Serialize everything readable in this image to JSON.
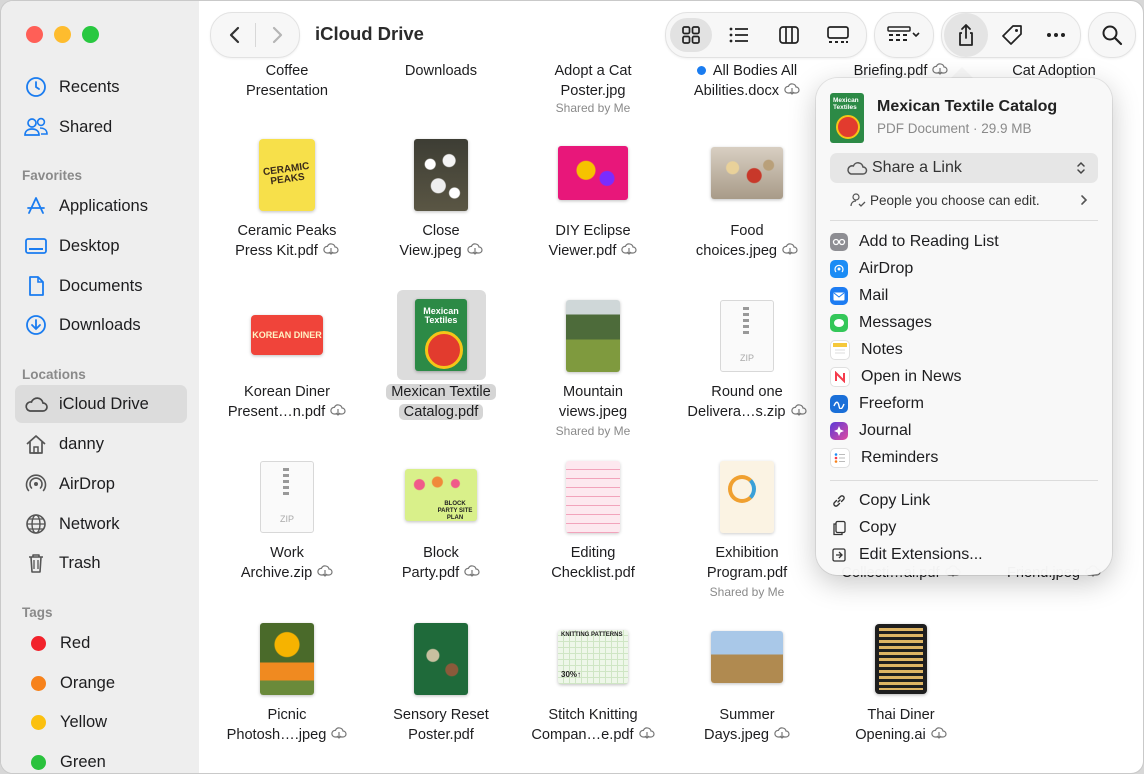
{
  "window": {
    "title": "iCloud Drive"
  },
  "sidebar": {
    "top_items": [
      {
        "label": "Recents",
        "icon": "clock-icon"
      },
      {
        "label": "Shared",
        "icon": "people-icon"
      }
    ],
    "favorites_header": "Favorites",
    "favorites": [
      {
        "label": "Applications",
        "icon": "applications-icon"
      },
      {
        "label": "Desktop",
        "icon": "desktop-icon"
      },
      {
        "label": "Documents",
        "icon": "document-icon"
      },
      {
        "label": "Downloads",
        "icon": "download-icon"
      }
    ],
    "locations_header": "Locations",
    "locations": [
      {
        "label": "iCloud Drive",
        "icon": "cloud-icon",
        "active": true
      },
      {
        "label": "danny",
        "icon": "home-icon"
      },
      {
        "label": "AirDrop",
        "icon": "airdrop-icon"
      },
      {
        "label": "Network",
        "icon": "globe-icon"
      },
      {
        "label": "Trash",
        "icon": "trash-icon"
      }
    ],
    "tags_header": "Tags",
    "tags": [
      {
        "label": "Red",
        "color": "#f2222b"
      },
      {
        "label": "Orange",
        "color": "#f7821b"
      },
      {
        "label": "Yellow",
        "color": "#fbc00f"
      },
      {
        "label": "Green",
        "color": "#2ac23d"
      }
    ]
  },
  "files": [
    {
      "l1": "Coffee",
      "l2": "Presentation"
    },
    {
      "l1": "Downloads",
      "l2": ""
    },
    {
      "l1": "Adopt a Cat",
      "l2": "Poster.jpg",
      "sub": "Shared by Me"
    },
    {
      "l1": "All Bodies All",
      "l2": "Abilities.docx"
    },
    {
      "l1": "Briefing.pdf",
      "l2": ""
    },
    {
      "l1": "Cat Adoption",
      "l2": ""
    },
    {
      "l1": "Ceramic Peaks",
      "l2": "Press Kit.pdf"
    },
    {
      "l1": "Close",
      "l2": "View.jpeg"
    },
    {
      "l1": "DIY Eclipse",
      "l2": "Viewer.pdf"
    },
    {
      "l1": "Food",
      "l2": "choices.jpeg"
    },
    {
      "l1": "Korean Diner",
      "l2": "Present…n.pdf"
    },
    {
      "l1": "Mexican Textile",
      "l2": "Catalog.pdf"
    },
    {
      "l1": "Mountain",
      "l2": "views.jpeg",
      "sub": "Shared by Me"
    },
    {
      "l1": "Round one",
      "l2": "Delivera…s.zip"
    },
    {
      "l1": "Work",
      "l2": "Archive.zip"
    },
    {
      "l1": "Block",
      "l2": "Party.pdf"
    },
    {
      "l1": "Editing",
      "l2": "Checklist.pdf"
    },
    {
      "l1": "Exhibition",
      "l2": "Program.pdf",
      "sub": "Shared by Me"
    },
    {
      "l1": "",
      "l2": "Collecti…ai.pdf"
    },
    {
      "l1": "",
      "l2": "Friend.jpeg"
    },
    {
      "l1": "Picnic",
      "l2": "Photosh….jpeg"
    },
    {
      "l1": "Sensory Reset",
      "l2": "Poster.pdf"
    },
    {
      "l1": "Stitch Knitting",
      "l2": "Compan…e.pdf"
    },
    {
      "l1": "Summer",
      "l2": "Days.jpeg"
    },
    {
      "l1": "Thai Diner",
      "l2": "Opening.ai"
    }
  ],
  "thumb_text": {
    "ceramic": "CERAMIC PEAKS",
    "korean": "KOREAN DINER",
    "mexican": "Mexican Textiles",
    "zip": "ZIP",
    "block": "BLOCK PARTY SITE PLAN",
    "knitting": "KNITTING PATTERNS",
    "knitting_pct": "30%↑"
  },
  "share": {
    "file_title": "Mexican Textile Catalog",
    "file_meta": "PDF Document · 29.9 MB",
    "thumb_text": "Mexican Textiles",
    "share_link": "Share a Link",
    "permission": "People you choose can edit.",
    "menu": [
      {
        "label": "Add to Reading List",
        "icon": "reading-list-icon",
        "color": "#8e8e93"
      },
      {
        "label": "AirDrop",
        "icon": "airdrop-icon",
        "color": "#1b8cf5"
      },
      {
        "label": "Mail",
        "icon": "mail-icon",
        "color": "#1d7cf2"
      },
      {
        "label": "Messages",
        "icon": "messages-icon",
        "color": "#34c759"
      },
      {
        "label": "Notes",
        "icon": "notes-icon",
        "color": "#f5c83a"
      },
      {
        "label": "Open in News",
        "icon": "news-icon",
        "color": "#f53b4c"
      },
      {
        "label": "Freeform",
        "icon": "freeform-icon",
        "color": "#1a6fd8"
      },
      {
        "label": "Journal",
        "icon": "journal-icon",
        "color": "#7b4de0"
      },
      {
        "label": "Reminders",
        "icon": "reminders-icon",
        "color": "#ffffff"
      }
    ],
    "menu2": [
      {
        "label": "Copy Link",
        "icon": "link-icon"
      },
      {
        "label": "Copy",
        "icon": "copy-icon"
      },
      {
        "label": "Edit Extensions...",
        "icon": "extensions-icon"
      }
    ]
  }
}
